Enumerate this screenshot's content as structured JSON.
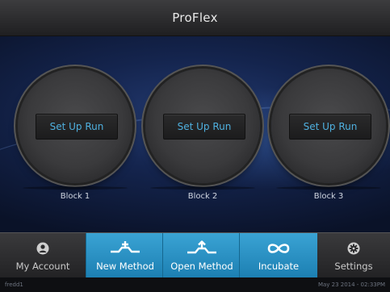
{
  "app": {
    "title": "ProFlex"
  },
  "blocks": [
    {
      "button_label": "Set Up Run",
      "label": "Block 1"
    },
    {
      "button_label": "Set Up Run",
      "label": "Block 2"
    },
    {
      "button_label": "Set Up Run",
      "label": "Block 3"
    }
  ],
  "nav": {
    "items": [
      {
        "label": "My Account",
        "icon": "account-icon",
        "active": false
      },
      {
        "label": "New Method",
        "icon": "new-method-icon",
        "active": true
      },
      {
        "label": "Open Method",
        "icon": "open-method-icon",
        "active": true
      },
      {
        "label": "Incubate",
        "icon": "infinity-icon",
        "active": true
      },
      {
        "label": "Settings",
        "icon": "gear-icon",
        "active": false
      }
    ]
  },
  "status": {
    "user": "fredd1",
    "datetime": "May 23 2014 - 02:33PM"
  },
  "colors": {
    "accent": "#2a93c8",
    "button_text": "#4fb0df",
    "background": "#14244d"
  }
}
